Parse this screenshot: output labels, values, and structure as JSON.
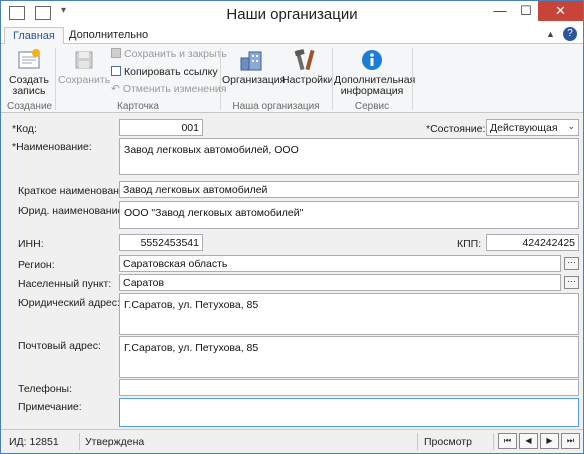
{
  "window": {
    "title": "Наши организации"
  },
  "ribbon": {
    "tabs": [
      "Главная",
      "Дополнительно"
    ],
    "create": {
      "label_1": "Создать",
      "label_2": "запись",
      "group": "Создание"
    },
    "save": {
      "label": "Сохранить"
    },
    "card": {
      "save_close": "Сохранить и закрыть",
      "copy_link": "Копировать ссылку",
      "undo": "Отменить изменения",
      "group": "Карточка"
    },
    "org": {
      "organization": "Организация",
      "settings": "Настройки",
      "group": "Наша организация"
    },
    "service": {
      "info_1": "Дополнительная",
      "info_2": "информация",
      "group": "Сервис"
    }
  },
  "form": {
    "code": {
      "label": "*Код:",
      "value": "001"
    },
    "state": {
      "label": "*Состояние:",
      "value": "Действующая"
    },
    "name": {
      "label": "*Наименование:",
      "value": "Завод легковых автомобилей, ООО"
    },
    "short_name": {
      "label": "Краткое наименование:",
      "value": "Завод легковых автомобилей"
    },
    "legal_name": {
      "label": "Юрид. наименование:",
      "value": "ООО \"Завод легковых автомобилей\""
    },
    "inn": {
      "label": "ИНН:",
      "value": "5552453541"
    },
    "kpp": {
      "label": "КПП:",
      "value": "424242425"
    },
    "region": {
      "label": "Регион:",
      "value": "Саратовская область"
    },
    "locality": {
      "label": "Населенный пункт:",
      "value": "Саратов"
    },
    "legal_address": {
      "label": "Юридический адрес:",
      "value": "Г.Саратов, ул. Петухова, 85"
    },
    "postal_address": {
      "label": "Почтовый адрес:",
      "value": "Г.Саратов, ул. Петухова, 85"
    },
    "phones": {
      "label": "Телефоны:",
      "value": ""
    },
    "note": {
      "label": "Примечание:",
      "value": ""
    }
  },
  "status": {
    "id": "ИД: 12851",
    "state": "Утверждена",
    "mode": "Просмотр"
  },
  "colors": {
    "accent": "#2b579a",
    "info_icon": "#1b7dd6",
    "close": "#c7443a"
  }
}
